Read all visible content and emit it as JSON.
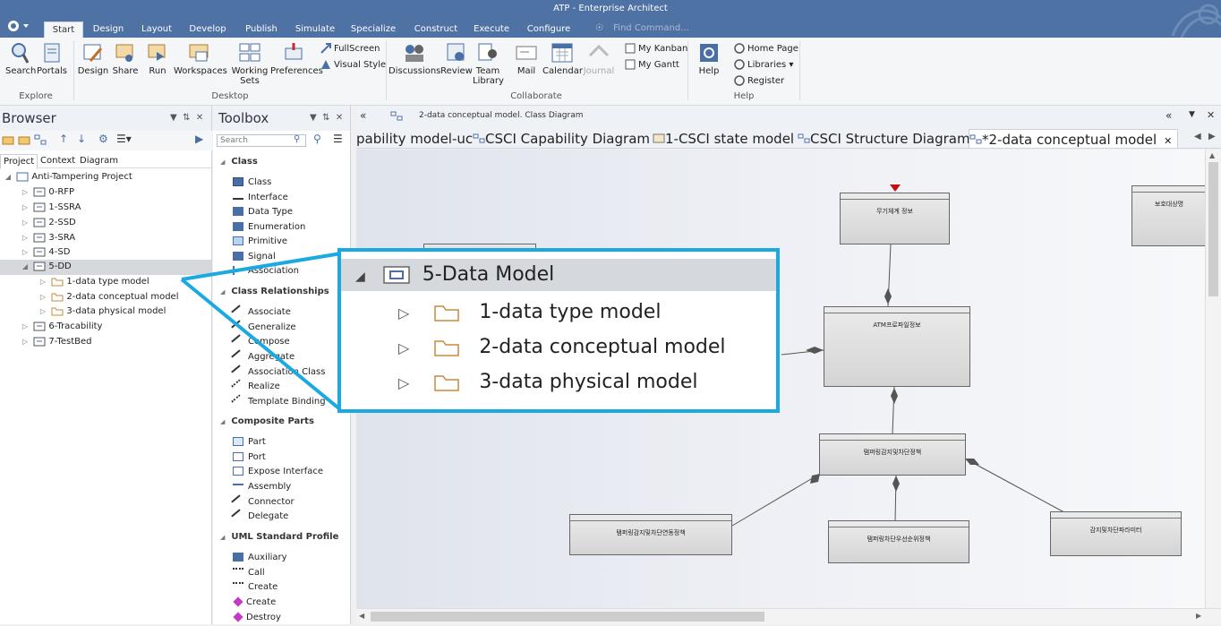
{
  "window": {
    "title": "ATP - Enterprise Architect"
  },
  "ribbon_tabs": [
    "Start",
    "Design",
    "Layout",
    "Develop",
    "Publish",
    "Simulate",
    "Specialize",
    "Construct",
    "Execute",
    "Configure"
  ],
  "find_command_placeholder": "Find Command...",
  "ribbon": {
    "explore": {
      "label": "Explore",
      "buttons": [
        "Search",
        "Portals"
      ]
    },
    "desktop": {
      "label": "Desktop",
      "buttons": [
        "Design",
        "Share",
        "Run",
        "Workspaces",
        "Working Sets",
        "Preferences"
      ],
      "small": [
        "FullScreen",
        "Visual Style"
      ]
    },
    "collaborate": {
      "label": "Collaborate",
      "buttons": [
        "Discussions",
        "Review",
        "Team Library",
        "Mail",
        "Calendar",
        "Journal"
      ],
      "small": [
        "My Kanban",
        "My Gantt"
      ]
    },
    "help": {
      "label": "Help",
      "buttons": [
        "Help"
      ],
      "small": [
        "Home Page",
        "Libraries",
        "Register"
      ]
    }
  },
  "browser": {
    "title": "Browser",
    "tabs": [
      "Project",
      "Context",
      "Diagram"
    ],
    "tree": [
      {
        "label": "Anti-Tampering Project",
        "level": 0,
        "expanded": true
      },
      {
        "label": "0-RFP",
        "level": 1
      },
      {
        "label": "1-SSRA",
        "level": 1
      },
      {
        "label": "2-SSD",
        "level": 1
      },
      {
        "label": "3-SRA",
        "level": 1
      },
      {
        "label": "4-SD",
        "level": 1
      },
      {
        "label": "5-DD",
        "level": 1,
        "expanded": true,
        "selected": true
      },
      {
        "label": "1-data type model",
        "level": 2
      },
      {
        "label": "2-data conceptual model",
        "level": 2
      },
      {
        "label": "3-data physical model",
        "level": 2
      },
      {
        "label": "6-Tracability",
        "level": 1
      },
      {
        "label": "7-TestBed",
        "level": 1
      }
    ]
  },
  "toolbox": {
    "title": "Toolbox",
    "search_placeholder": "Search",
    "groups": [
      {
        "name": "Class",
        "items": [
          "Class",
          "Interface",
          "Data Type",
          "Enumeration",
          "Primitive",
          "Signal",
          "Association"
        ]
      },
      {
        "name": "Class Relationships",
        "items": [
          "Associate",
          "Generalize",
          "Compose",
          "Aggregate",
          "Association Class",
          "Realize",
          "Template Binding"
        ]
      },
      {
        "name": "Composite Parts",
        "items": [
          "Part",
          "Port",
          "Expose Interface",
          "Assembly",
          "Connector",
          "Delegate"
        ]
      },
      {
        "name": "UML Standard Profile",
        "items": [
          "Auxiliary",
          "Call",
          "Create",
          "Create",
          "Destroy"
        ]
      }
    ]
  },
  "diagram": {
    "breadcrumb": "2-data conceptual model.  Class Diagram",
    "tabs": [
      "pability model-uc",
      "CSCI Capability Diagram",
      "1-CSCI state model",
      "CSCI Structure Diagram",
      "*2-data conceptual model"
    ],
    "classes": [
      "무기체계 정보",
      "보호대상명",
      "ATM프로파일정보",
      "탬퍼링감지및차단정책",
      "탬퍼링감지및차단연동정책",
      "탬퍼링차단우선순위정책",
      "감지및차단파라미터"
    ]
  },
  "callout": {
    "title": "5-Data Model",
    "items": [
      "1-data type model",
      "2-data conceptual model",
      "3-data physical model"
    ]
  },
  "colors": {
    "titlebar": "#4d72a3",
    "callout_border": "#1aa9e0",
    "selection": "#d5d8dc",
    "folder": "#c78a3c"
  }
}
